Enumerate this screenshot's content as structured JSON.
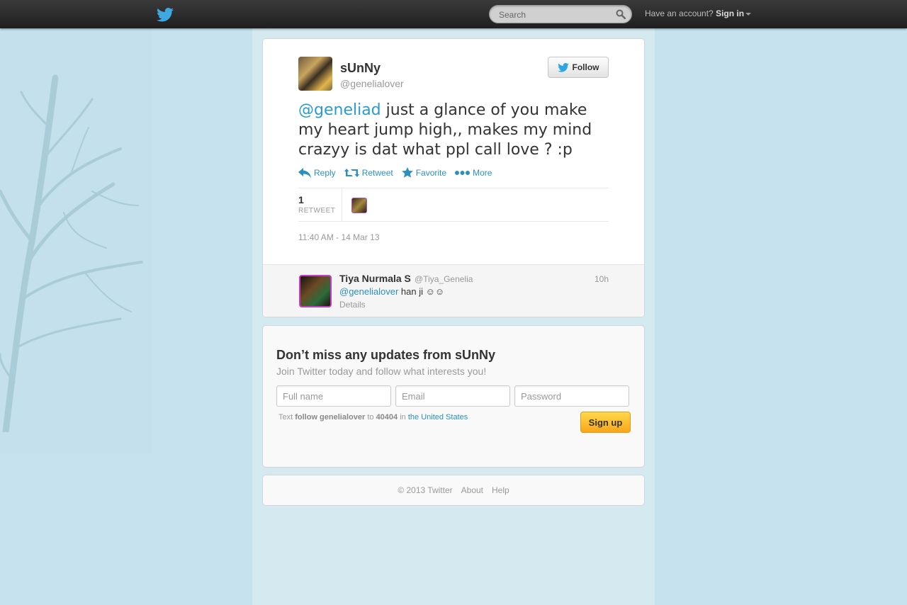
{
  "topbar": {
    "search_placeholder": "Search",
    "signin_prompt": "Have an account?",
    "signin_label": "Sign in"
  },
  "tweet": {
    "display_name": "sUnNy",
    "screen_name": "@genelialover",
    "follow_label": "Follow",
    "mention": "@geneliad",
    "text_rest": " just a glance of you make my heart jump high,, makes my mind crazyy is dat what ppl call love ? :p",
    "actions": {
      "reply": "Reply",
      "retweet": "Retweet",
      "favorite": "Favorite",
      "more": "More"
    },
    "retweet_count": "1",
    "retweet_label": "RETWEET",
    "timestamp": "11:40 AM - 14 Mar 13"
  },
  "reply": {
    "name": "Tiya Nurmala S",
    "handle": "@Tiya_Genelia",
    "time": "10h",
    "mention": "@genelialover",
    "text": " han ji ☺☺",
    "details": "Details"
  },
  "signup": {
    "title": "Don’t miss any updates from sUnNy",
    "subtitle": "Join Twitter today and follow what interests you!",
    "fullname_placeholder": "Full name",
    "email_placeholder": "Email",
    "password_placeholder": "Password",
    "sms_prefix": "Text ",
    "sms_command": "follow genelialover",
    "sms_to": " to ",
    "sms_number": "40404",
    "sms_in": " in ",
    "sms_country": "the United States",
    "button": "Sign up"
  },
  "footer": {
    "copyright": "© 2013 Twitter",
    "about": "About",
    "help": "Help"
  },
  "colors": {
    "link": "#2b9acd",
    "background": "#c6e2ee",
    "signup_button": "#f9a61b"
  }
}
